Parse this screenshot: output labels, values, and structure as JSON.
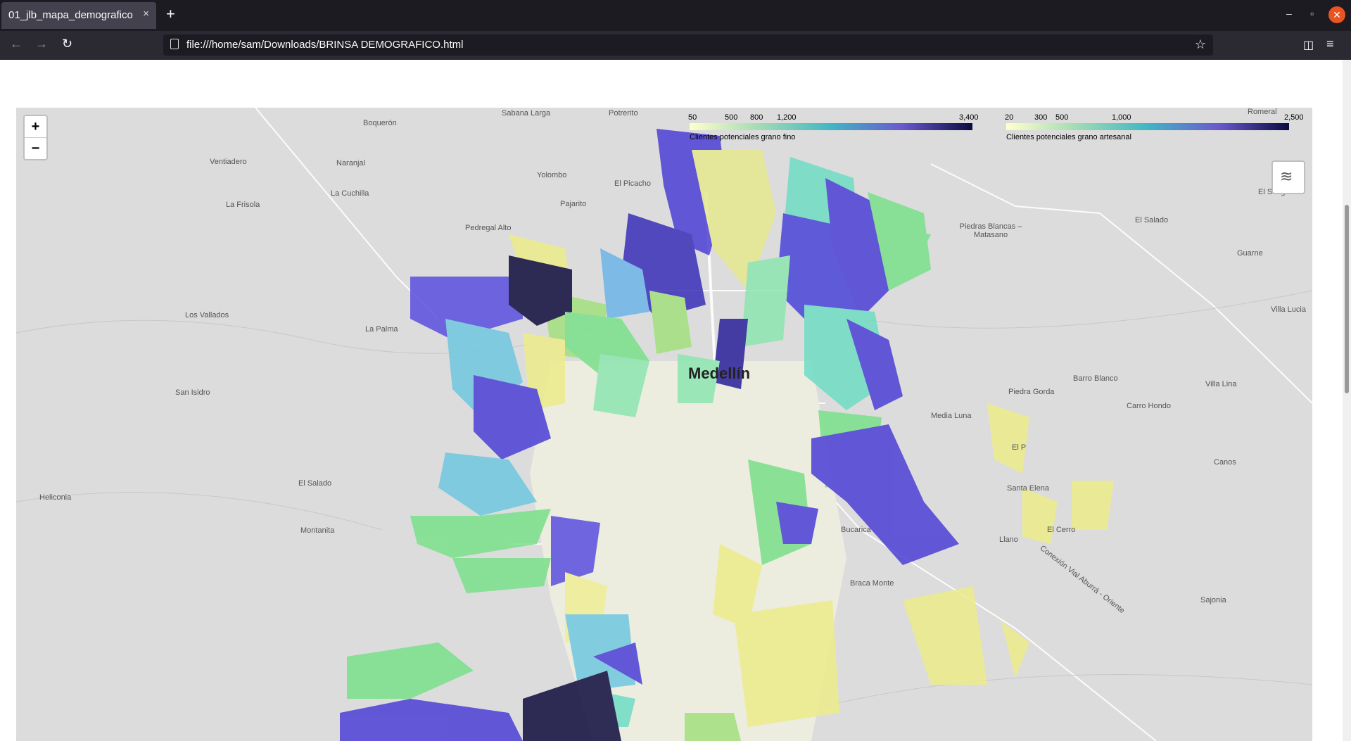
{
  "browser": {
    "tab_title": "01_jlb_mapa_demografico",
    "tab_close": "×",
    "new_tab": "+",
    "url": "file:///home/sam/Downloads/BRINSA DEMOGRAFICO.html",
    "win_minimize": "–",
    "win_restore": "▫",
    "win_close": "✕",
    "back": "←",
    "forward": "→",
    "reload": "↻",
    "bookmark": "☆",
    "pocket": "◫",
    "menu": "≡"
  },
  "map": {
    "zoom_in": "+",
    "zoom_out": "−",
    "layers_icon": "layers-icon",
    "center_label": "Medellín",
    "places": [
      "Sabana Larga",
      "Potrerito",
      "Boquerón",
      "Ventiadero",
      "Naranjal",
      "Yolombo",
      "El Picacho",
      "La Cuchilla",
      "La Frisola",
      "Pajarito",
      "Pedregal Alto",
      "Los Vallados",
      "La Palma",
      "San Isidro",
      "El Salado",
      "Heliconia",
      "Montanita",
      "El Sango",
      "El Salado",
      "Piedras Blancas – Matasano",
      "Guarne",
      "Villa Lucia",
      "Barro Blanco",
      "Villa Lina",
      "Carro Hondo",
      "Media Luna",
      "Piedra Gorda",
      "El P",
      "Canos",
      "Bucarica",
      "Llano",
      "El Cerro",
      "Braca Monte",
      "Sajonia",
      "Romeral",
      "Conexión Vial Aburrá - Oriente",
      "Santa Elena"
    ]
  },
  "legends": [
    {
      "ticks": [
        "50",
        "500",
        "800",
        "1,200",
        "3,400"
      ],
      "caption": "Clientes potenciales grano fino",
      "colors": [
        "#ffffcc",
        "#a1dab4",
        "#41b6c4",
        "#6a5acd",
        "#0a0a40"
      ]
    },
    {
      "ticks": [
        "20",
        "300",
        "500",
        "1,000",
        "2,500"
      ],
      "caption": "Clientes potenciales grano artesanal",
      "colors": [
        "#ffffcc",
        "#a1dab4",
        "#41b6c4",
        "#6a5acd",
        "#0a0a40"
      ]
    }
  ]
}
